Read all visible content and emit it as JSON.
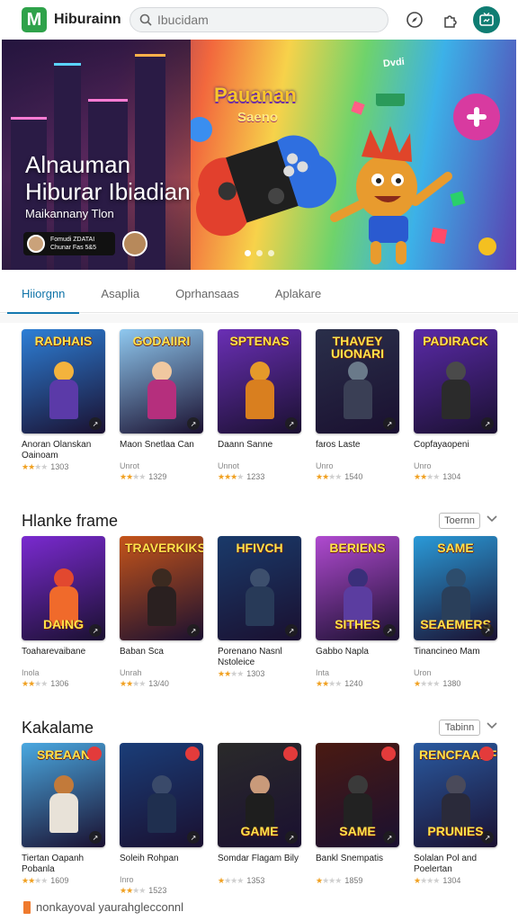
{
  "header": {
    "logo_letter": "M",
    "app_title": "Hiburainn",
    "search_placeholder": "Ibucidam",
    "icons": [
      "compass-icon",
      "puzzle-icon",
      "tv-icon"
    ],
    "accent": "#0f7d73"
  },
  "hero": {
    "title_line1": "Alnauman",
    "title_line2": "Hiburar Ibiadian",
    "subtitle": "Maikannany Tlon",
    "chip_line1": "Fomudi ZDATAI",
    "chip_line2": "Chunar Fas 5&5",
    "game_logo_line1": "Pauanan",
    "game_logo_line2": "Saeno",
    "tile_text": "Dvdi",
    "slide_count": 3,
    "active_slide": 1
  },
  "tabs": [
    {
      "label": "Hiiorgnn",
      "active": true
    },
    {
      "label": "Asaplia",
      "active": false
    },
    {
      "label": "Oprhansaas",
      "active": false
    },
    {
      "label": "Aplakare",
      "active": false
    }
  ],
  "sections": [
    {
      "title": "",
      "button": "",
      "items": [
        {
          "title": "Anoran Olanskan Oainoam",
          "sub": "",
          "stars": 2,
          "count": "1303",
          "top": "RADHAIS",
          "bottom": "",
          "bg": "#2d7fd6",
          "char": "#f3b33d",
          "body": "#5b3aa8"
        },
        {
          "title": "Maon Snetlaa Can",
          "sub": "Unrot",
          "stars": 2,
          "count": "1329",
          "top": "GODAIIRI",
          "bottom": "",
          "bg": "#8fc8ef",
          "char": "#f0c8a0",
          "body": "#b52f7d"
        },
        {
          "title": "Daann Sanne",
          "sub": "Unnot",
          "stars": 3,
          "count": "1233",
          "top": "SPTENAS",
          "bottom": "",
          "bg": "#6a2fb5",
          "char": "#e59a2a",
          "body": "#d97f1f"
        },
        {
          "title": "faros Laste",
          "sub": "Unro",
          "stars": 2,
          "count": "1540",
          "top": "THAVEY UIONARI",
          "bottom": "",
          "bg": "#2a2f4a",
          "char": "#6a7a8a",
          "body": "#3a3f55"
        },
        {
          "title": "Copfayaopeni",
          "sub": "Unro",
          "stars": 2,
          "count": "1304",
          "top": "PADIRACK",
          "bottom": "",
          "bg": "#5a2aa8",
          "char": "#4a4a4a",
          "body": "#2b2b2b"
        }
      ]
    },
    {
      "title": "Hlanke frame",
      "button": "Toernn",
      "items": [
        {
          "title": "Toaharevaibane",
          "sub": "Inola",
          "stars": 2,
          "count": "1306",
          "top": "",
          "bottom": "DAING",
          "bg": "#7a2ad0",
          "char": "#e2482f",
          "body": "#f06a2b"
        },
        {
          "title": "Baban Sca",
          "sub": "Unrah",
          "stars": 2,
          "count": "13/40",
          "top": "TRAVERKIKSE",
          "bottom": "",
          "bg": "#c5541a",
          "char": "#3b2a20",
          "body": "#2a2020"
        },
        {
          "title": "Porenano Nasnl Nstoleice",
          "sub": "",
          "stars": 2,
          "count": "1303",
          "top": "HFIVCH",
          "bottom": "",
          "bg": "#1a3a6a",
          "char": "#3d4f6d",
          "body": "#283a58"
        },
        {
          "title": "Gabbo Napla",
          "sub": "Inta",
          "stars": 2,
          "count": "1240",
          "top": "BERIENS",
          "bottom": "SITHES",
          "bg": "#b04ad0",
          "char": "#3a2f7a",
          "body": "#5b3da0"
        },
        {
          "title": "Tinancineo Mam",
          "sub": "Uron",
          "stars": 1,
          "count": "1380",
          "top": "SAME",
          "bottom": "SEAEMERS",
          "bg": "#2a9ad8",
          "char": "#2d4d6d",
          "body": "#2a3f5a"
        }
      ]
    },
    {
      "title": "Kakalame",
      "button": "Tabinn",
      "items": [
        {
          "title": "Tiertan Oapanh Pobanla",
          "sub": "",
          "stars": 2,
          "count": "1609",
          "top": "SREAAN",
          "bottom": "",
          "bg": "#4aa8e0",
          "char": "#c27a3a",
          "body": "#e8e2d8"
        },
        {
          "title": "Soleih Rohpan",
          "sub": "Inro",
          "stars": 2,
          "count": "1523",
          "top": "",
          "bottom": "",
          "bg": "#1a3d78",
          "char": "#3a4a6a",
          "body": "#1f2f4f"
        },
        {
          "title": "Somdar Flagam Bily",
          "sub": "",
          "stars": 1,
          "count": "1353",
          "top": "",
          "bottom": "GAME",
          "bg": "#2a2a2a",
          "char": "#c99a7a",
          "body": "#1e1e1e"
        },
        {
          "title": "Bankl Snempatis",
          "sub": "",
          "stars": 1,
          "count": "1859",
          "top": "",
          "bottom": "SAME",
          "bg": "#4a1a12",
          "char": "#3a3a3a",
          "body": "#222"
        },
        {
          "title": "Solalan Pol and Poelertan",
          "sub": "",
          "stars": 1,
          "count": "1304",
          "top": "RENCFAANF",
          "bottom": "PRUNIES",
          "bg": "#2a5aa0",
          "char": "#4a4a5a",
          "body": "#2a2a3a"
        }
      ]
    }
  ],
  "footer": {
    "text": "nonkayoval yaurahglecconnl"
  }
}
